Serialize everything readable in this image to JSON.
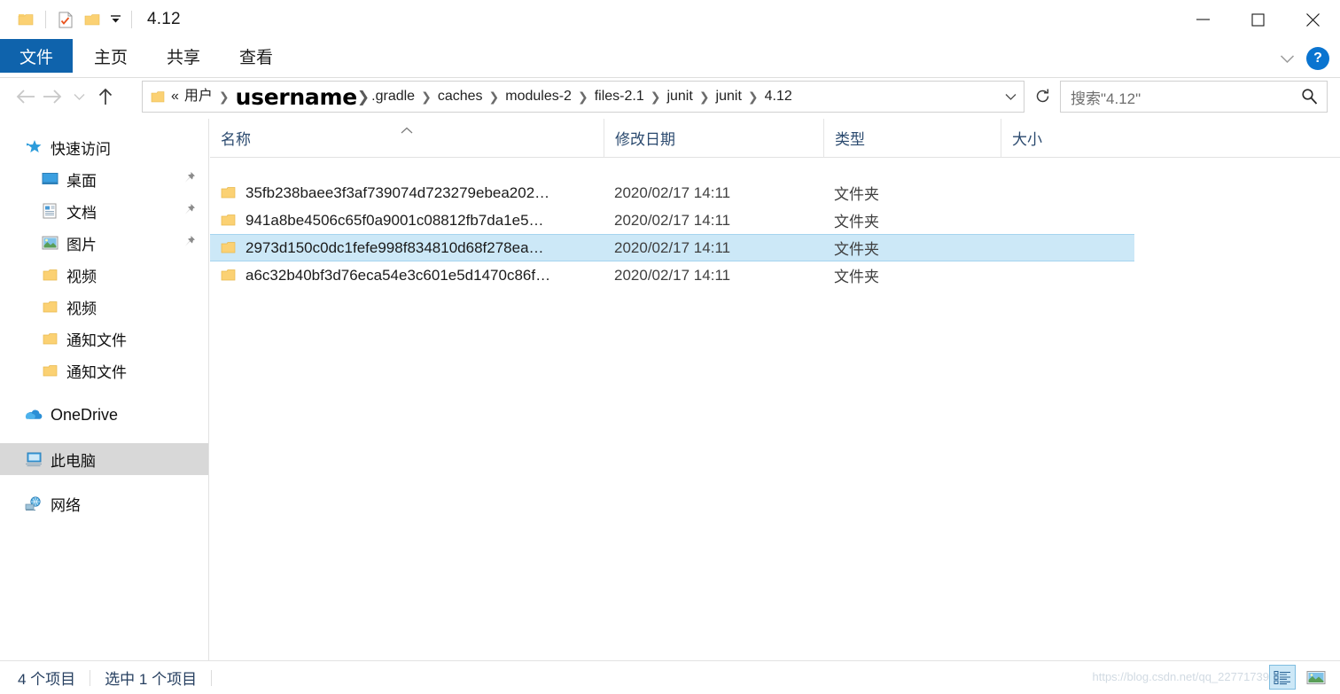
{
  "window": {
    "title": "4.12",
    "quick_access": [
      {
        "name": "folder-icon",
        "label": "文件夹"
      },
      {
        "name": "properties-icon",
        "label": "属性"
      },
      {
        "name": "new-folder-icon",
        "label": "新建文件夹"
      },
      {
        "name": "customize-caret-icon",
        "label": "自定义快速访问工具栏"
      }
    ],
    "controls": {
      "minimize": "最小化",
      "maximize": "最大化",
      "close": "关闭"
    }
  },
  "ribbon": {
    "tabs": [
      {
        "label": "文件",
        "active": true
      },
      {
        "label": "主页",
        "active": false
      },
      {
        "label": "共享",
        "active": false
      },
      {
        "label": "查看",
        "active": false
      }
    ],
    "collapse_label": "折叠功能区",
    "help_label": "?"
  },
  "navigation": {
    "back_label": "后退",
    "forward_label": "前进",
    "recent_label": "最近浏览的位置",
    "up_label": "上一级",
    "refresh_label": "刷新",
    "breadcrumb": [
      {
        "label": "«",
        "type": "overflow"
      },
      {
        "label": "用户",
        "type": "crumb"
      },
      {
        "label": "username",
        "type": "redacted"
      },
      {
        "label": ".gradle",
        "type": "crumb"
      },
      {
        "label": "caches",
        "type": "crumb"
      },
      {
        "label": "modules-2",
        "type": "crumb"
      },
      {
        "label": "files-2.1",
        "type": "crumb"
      },
      {
        "label": "junit",
        "type": "crumb"
      },
      {
        "label": "junit",
        "type": "crumb"
      },
      {
        "label": "4.12",
        "type": "crumb"
      }
    ]
  },
  "search": {
    "placeholder": "搜索\"4.12\"",
    "icon": "search-icon"
  },
  "sidebar": {
    "items": [
      {
        "label": "快速访问",
        "icon": "star-icon",
        "level": "root",
        "pinned": false,
        "selected": false
      },
      {
        "label": "桌面",
        "icon": "desktop-icon",
        "level": "child",
        "pinned": true,
        "selected": false
      },
      {
        "label": "文档",
        "icon": "documents-icon",
        "level": "child",
        "pinned": true,
        "selected": false
      },
      {
        "label": "图片",
        "icon": "pictures-icon",
        "level": "child",
        "pinned": true,
        "selected": false
      },
      {
        "label": "视频",
        "icon": "folder-icon",
        "level": "child",
        "pinned": false,
        "selected": false
      },
      {
        "label": "视频",
        "icon": "folder-icon",
        "level": "child",
        "pinned": false,
        "selected": false
      },
      {
        "label": "通知文件",
        "icon": "folder-icon",
        "level": "child",
        "pinned": false,
        "selected": false
      },
      {
        "label": "通知文件",
        "icon": "folder-icon",
        "level": "child",
        "pinned": false,
        "selected": false
      }
    ],
    "roots": [
      {
        "label": "OneDrive",
        "icon": "onedrive-icon",
        "latin": true,
        "selected": false
      },
      {
        "label": "此电脑",
        "icon": "this-pc-icon",
        "latin": false,
        "selected": true
      },
      {
        "label": "网络",
        "icon": "network-icon",
        "latin": false,
        "selected": false
      }
    ]
  },
  "filelist": {
    "columns": [
      {
        "label": "名称",
        "key": "name",
        "sorted": "asc"
      },
      {
        "label": "修改日期",
        "key": "date",
        "sorted": null
      },
      {
        "label": "类型",
        "key": "type",
        "sorted": null
      },
      {
        "label": "大小",
        "key": "size",
        "sorted": null
      }
    ],
    "rows": [
      {
        "name": "35fb238baee3f3af739074d723279ebea202…",
        "date": "2020/02/17 14:11",
        "type": "文件夹",
        "size": "",
        "selected": false
      },
      {
        "name": "941a8be4506c65f0a9001c08812fb7da1e5…",
        "date": "2020/02/17 14:11",
        "type": "文件夹",
        "size": "",
        "selected": false
      },
      {
        "name": "2973d150c0dc1fefe998f834810d68f278ea…",
        "date": "2020/02/17 14:11",
        "type": "文件夹",
        "size": "",
        "selected": true
      },
      {
        "name": "a6c32b40bf3d76eca54e3c601e5d1470c86f…",
        "date": "2020/02/17 14:11",
        "type": "文件夹",
        "size": "",
        "selected": false
      }
    ]
  },
  "statusbar": {
    "item_count": "4 个项目",
    "selection": "选中 1 个项目",
    "details_view_label": "详细信息",
    "large_icons_view_label": "大图标",
    "watermark": "https://blog.csdn.net/qq_22771739"
  },
  "colors": {
    "accent": "#0f63ac",
    "selection": "#cce8f7",
    "selection_border": "#a6d4ef",
    "nav_selected": "#d8d8d8",
    "header_text": "#2b4a6f",
    "folder_yellow": "#f7d180"
  }
}
